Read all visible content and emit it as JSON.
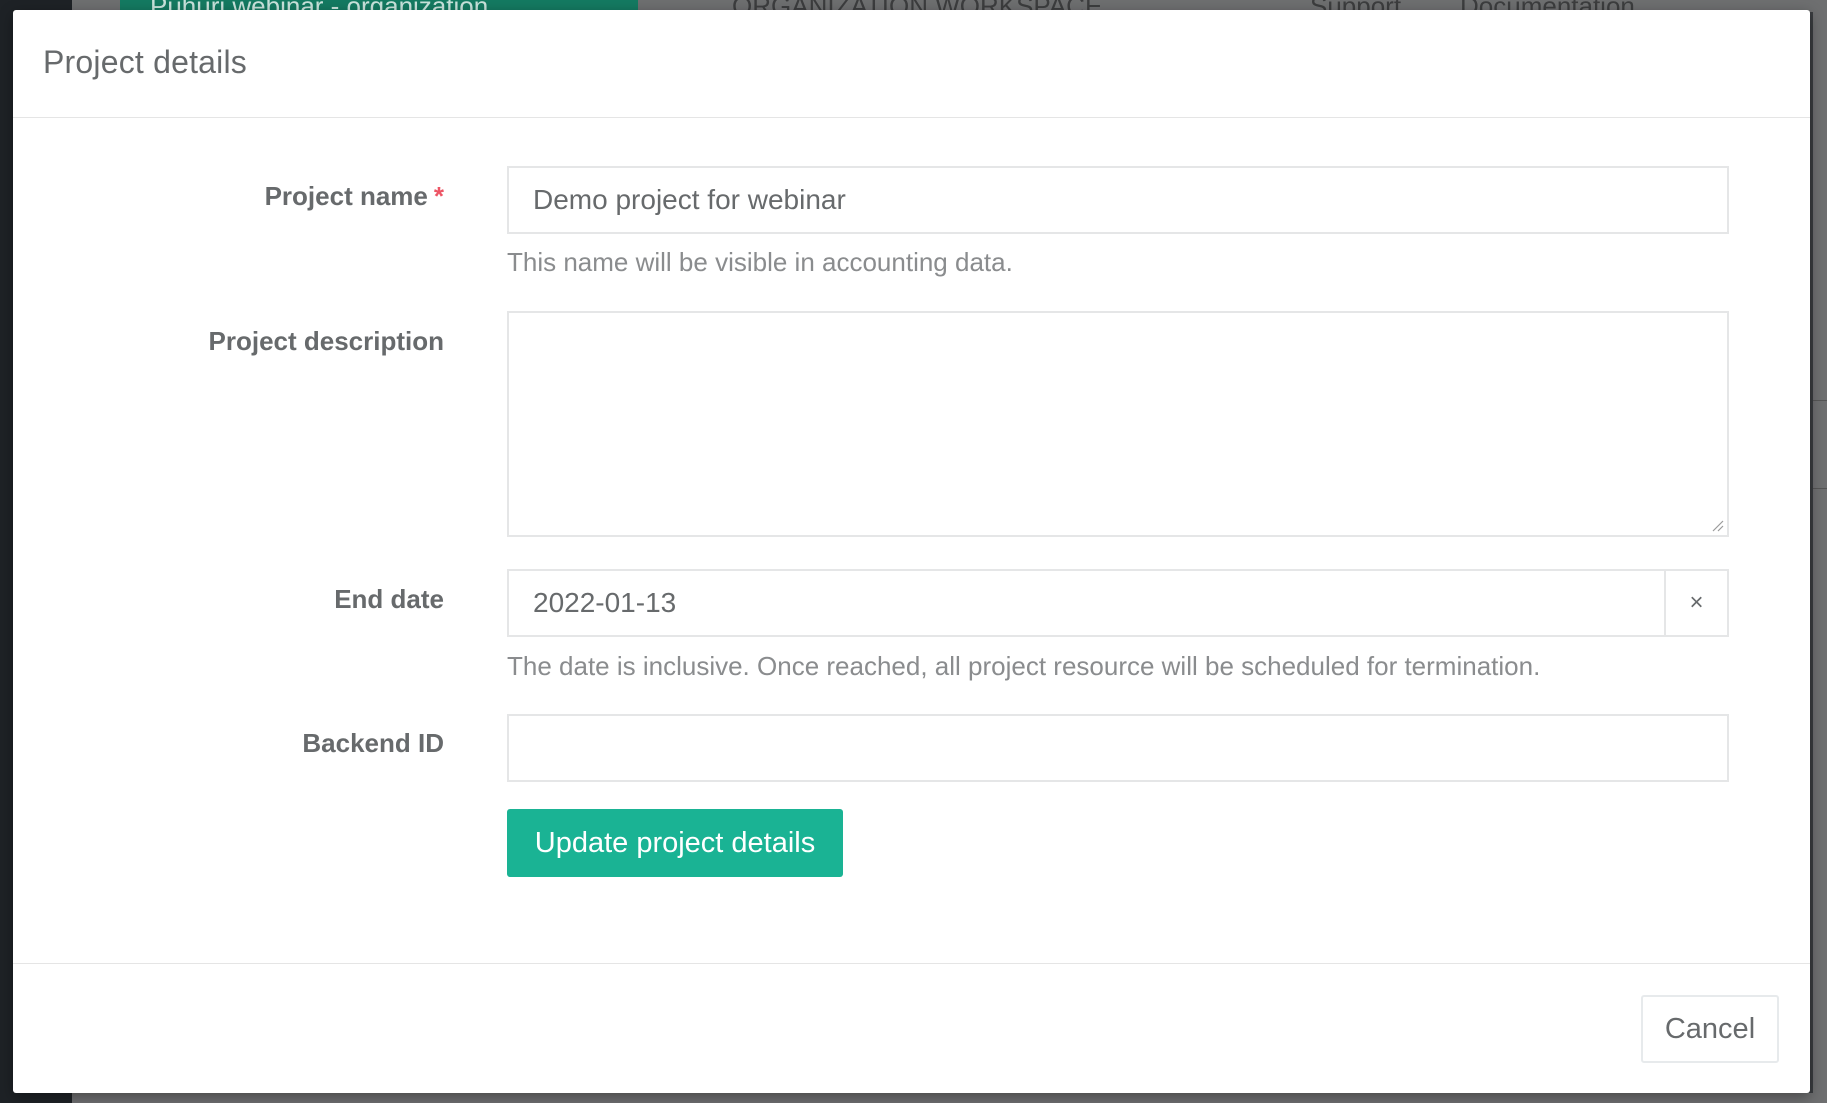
{
  "backdrop": {
    "org_tab_label": "Puhuri webinar - organization",
    "workspace_title": "ORGANIZATION WORKSPACE",
    "support_link": "Support",
    "documentation_link": "Documentation"
  },
  "modal": {
    "title": "Project details",
    "fields": {
      "project_name": {
        "label": "Project name",
        "required_marker": "*",
        "value": "Demo project for webinar",
        "help": "This name will be visible in accounting data."
      },
      "project_description": {
        "label": "Project description",
        "value": ""
      },
      "end_date": {
        "label": "End date",
        "value": "2022-01-13",
        "clear_label": "×",
        "help": "The date is inclusive. Once reached, all project resource will be scheduled for termination."
      },
      "backend_id": {
        "label": "Backend ID",
        "value": ""
      }
    },
    "submit_label": "Update project details",
    "cancel_label": "Cancel"
  },
  "colors": {
    "primary": "#1ab394",
    "required": "#ed5565",
    "text": "#676a6c"
  }
}
